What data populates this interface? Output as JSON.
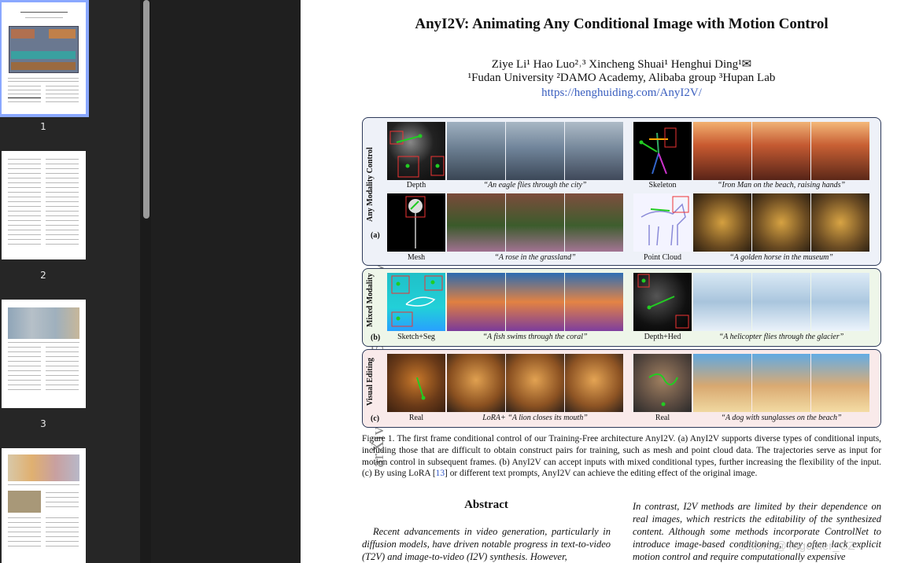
{
  "thumbnails": [
    {
      "page": "1"
    },
    {
      "page": "2"
    },
    {
      "page": "3"
    },
    {
      "page": ""
    }
  ],
  "paper": {
    "arxiv_id": "arXiv:2507.02857v1  [cs.CV]  3 Jul 2025",
    "title": "AnyI2V: Animating Any Conditional Image with Motion Control",
    "authors": "Ziye Li¹    Hao Luo²˒³    Xincheng Shuai¹    Henghui Ding¹✉",
    "affiliations": "¹Fudan University   ²DAMO Academy, Alibaba group   ³Hupan Lab",
    "url": "https://henghuiding.com/AnyI2V/"
  },
  "figure": {
    "panel_a_label": "Any Modality Control",
    "panel_a_letter": "(a)",
    "panel_b_label": "Mixed Modality",
    "panel_b_letter": "(b)",
    "panel_c_label": "Visual Editing",
    "panel_c_letter": "(c)",
    "captions": {
      "depth": "Depth",
      "eagle": "“An eagle flies through the city”",
      "skeleton": "Skeleton",
      "ironman": "“Iron Man on the beach, raising hands”",
      "mesh": "Mesh",
      "rose": "“A rose in the grassland”",
      "pointcloud": "Point Cloud",
      "horse": "“A golden horse in the museum”",
      "sketchseg": "Sketch+Seg",
      "fish": "“A fish swims through the coral”",
      "depthhed": "Depth+Hed",
      "heli": "“A helicopter flies through the glacier”",
      "real1": "Real",
      "lion": "LoRA+ “A lion closes its mouth”",
      "real2": "Real",
      "dog": "“A dog with sunglasses on the beach”"
    },
    "caption_text_1": "Figure 1. The first frame conditional control of our Training-Free architecture AnyI2V. (a) AnyI2V supports diverse types of conditional inputs, including those that are difficult to obtain construct pairs for training, such as mesh and point cloud data. The trajectories serve as input for motion control in subsequent frames. (b) AnyI2V can accept inputs with mixed conditional types, further increasing the flexibility of the input. (c) By using LoRA [",
    "caption_ref": "13",
    "caption_text_2": "] or different text prompts, AnyI2V can achieve the editing effect of the original image."
  },
  "abstract": {
    "title": "Abstract",
    "left_text": "Recent advancements in video generation, particularly in diffusion models, have driven notable progress in text-to-video (T2V) and image-to-video (I2V) synthesis. However,",
    "right_text": "In contrast, I2V methods are limited by their dependence on real images, which restricts the editability of the synthesized content. Although some methods incorporate ControlNet to introduce image-based conditioning, they often lack explicit motion control and require computationally expensive"
  },
  "watermark": "CSDN @Together_CZ",
  "colors": {
    "accent_selected": "#8aa8ff",
    "link": "#3b5fbf",
    "panel_border": "#2d3a5a"
  }
}
